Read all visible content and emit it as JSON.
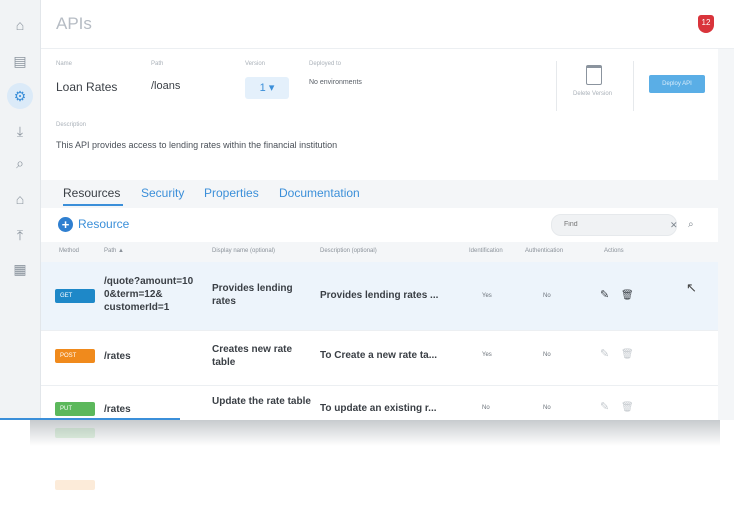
{
  "page": {
    "title": "APIs",
    "notification_count": "12"
  },
  "sidebar": {
    "items": [
      {
        "name": "home-icon",
        "glyph": "⌂"
      },
      {
        "name": "catalog-icon",
        "glyph": "▤"
      },
      {
        "name": "apis-icon",
        "glyph": "⚙"
      },
      {
        "name": "download-icon",
        "glyph": "⤓"
      },
      {
        "name": "search-analytics-icon",
        "glyph": "⌕"
      },
      {
        "name": "lock-icon",
        "glyph": "⌂"
      },
      {
        "name": "upload-icon",
        "glyph": "⤒"
      },
      {
        "name": "dashboard-icon",
        "glyph": "▦"
      }
    ]
  },
  "api": {
    "name_label": "Name",
    "name": "Loan Rates",
    "path_label": "Path",
    "path": "/loans",
    "version_label": "Version",
    "version": "1 ▾",
    "deployed_label": "Deployed to",
    "deployed": "No environments",
    "delete_label": "Delete Version",
    "deploy_button": "Deploy API",
    "description_label": "Description",
    "description": "This API provides access to lending rates within the financial institution"
  },
  "tabs": [
    "Resources",
    "Security",
    "Properties",
    "Documentation"
  ],
  "resources": {
    "add_label": "Resource",
    "find_placeholder": "Find",
    "columns": [
      "Method",
      "Path ▲",
      "Display name (optional)",
      "Description (optional)",
      "Identification",
      "Authentication",
      "Actions"
    ],
    "rows": [
      {
        "method": "GET",
        "color": "#1e88c8",
        "path": "/quote?amount=10 0&term=12& customerId=1",
        "name": "Provides lending rates",
        "desc": "Provides lending rates ...",
        "ident": "Yes",
        "auth": "No",
        "selected": true
      },
      {
        "method": "POST",
        "color": "#f08a1c",
        "path": "/rates",
        "name": "Creates new rate table",
        "desc": "To Create a new rate ta...",
        "ident": "Yes",
        "auth": "No",
        "selected": false
      },
      {
        "method": "PUT",
        "color": "#5cb85c",
        "path": "/rates",
        "name": "Update the rate table",
        "desc": "To update an existing r...",
        "ident": "No",
        "auth": "No",
        "selected": false
      }
    ]
  }
}
